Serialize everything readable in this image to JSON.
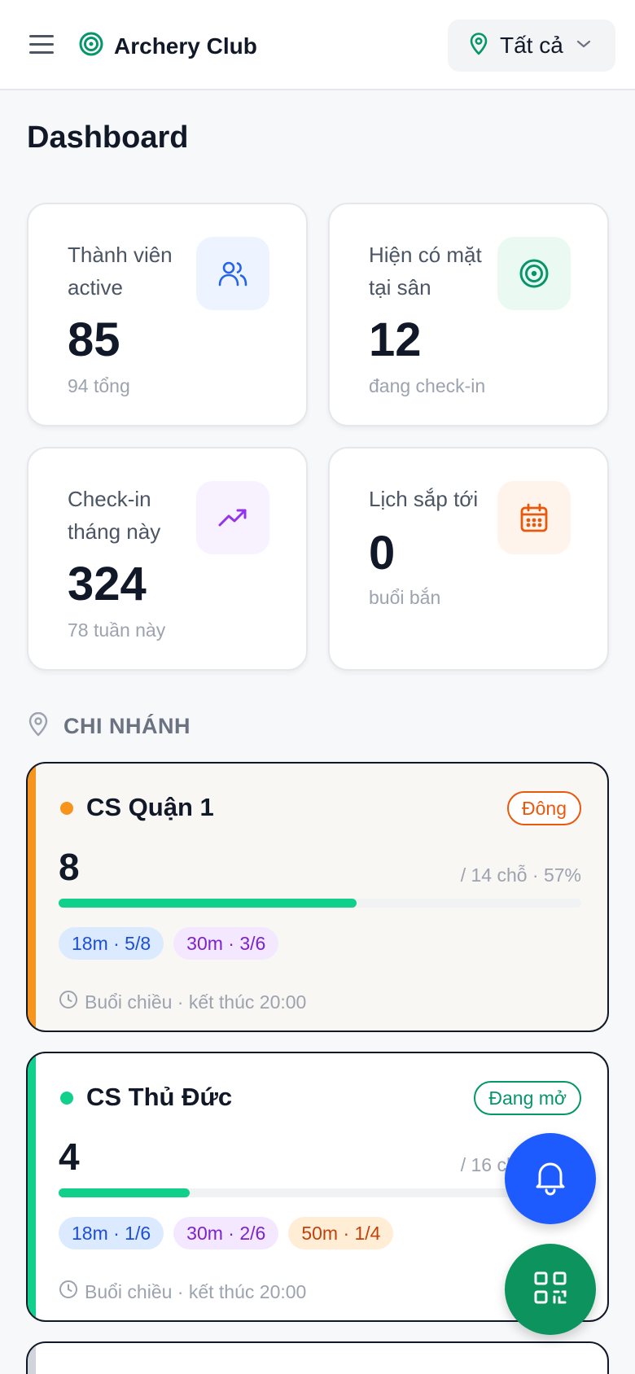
{
  "header": {
    "brand_title": "Archery Club",
    "location_label": "Tất cả"
  },
  "page": {
    "title": "Dashboard"
  },
  "stats": [
    {
      "label": "Thành viên active",
      "value": "85",
      "sub": "94 tổng",
      "icon": "users-icon",
      "color": "#2563eb",
      "bg": "#eef4ff"
    },
    {
      "label": "Hiện có mặt tại sân",
      "value": "12",
      "sub": "đang check-in",
      "icon": "target-icon",
      "color": "#059669",
      "bg": "#eafaf2"
    },
    {
      "label": "Check-in tháng này",
      "value": "324",
      "sub": "78 tuần này",
      "icon": "trending-up-icon",
      "color": "#9333ea",
      "bg": "#f8f1ff"
    },
    {
      "label": "Lịch sắp tới",
      "value": "0",
      "sub": "buổi bắn",
      "icon": "calendar-icon",
      "color": "#ea580c",
      "bg": "#fff4ec"
    }
  ],
  "branches_section": {
    "title": "CHI NHÁNH"
  },
  "branches": [
    {
      "name": "CS Quận 1",
      "status": "Đông",
      "status_color": "#ea580c",
      "accent": "#f7941d",
      "card_bg": "#f9f7f3",
      "count": "8",
      "capacity_text": "/ 14 chỗ · 57%",
      "fill_fraction": 0.57,
      "chips": [
        {
          "text": "18m · 5/8",
          "kind": "c18"
        },
        {
          "text": "30m · 3/6",
          "kind": "c30"
        }
      ],
      "session": "Buổi chiều · kết thúc 20:00"
    },
    {
      "name": "CS Thủ Đức",
      "status": "Đang mở",
      "status_color": "#059669",
      "accent": "#10d08b",
      "card_bg": "#ffffff",
      "count": "4",
      "capacity_text": "/ 16 chỗ · 25%",
      "fill_fraction": 0.25,
      "chips": [
        {
          "text": "18m · 1/6",
          "kind": "c18"
        },
        {
          "text": "30m · 2/6",
          "kind": "c30"
        },
        {
          "text": "50m · 1/4",
          "kind": "c50"
        }
      ],
      "session": "Buổi chiều · kết thúc 20:00"
    }
  ],
  "fabs": {
    "notify_color": "#1d5bff",
    "qr_color": "#0d945e"
  }
}
